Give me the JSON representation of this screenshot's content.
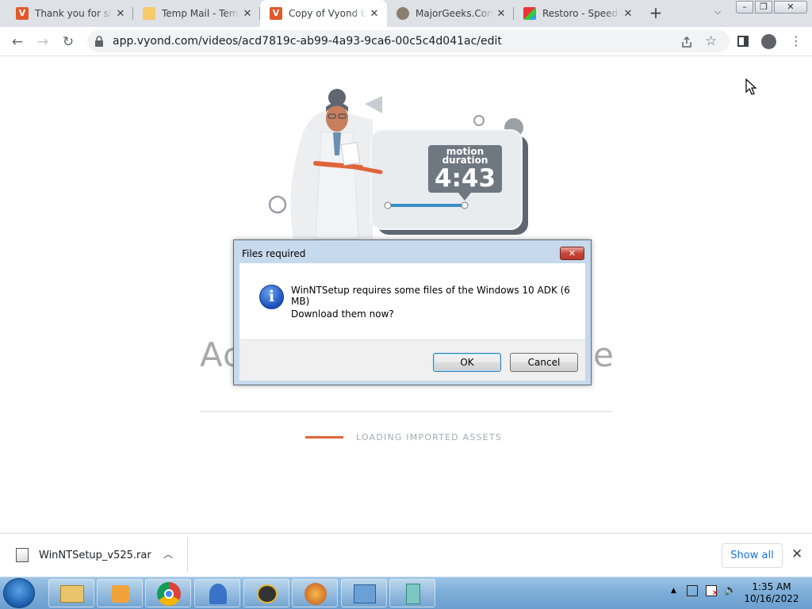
{
  "browser": {
    "tabs": [
      {
        "title": "Thank you for signing up",
        "icon": "vyond-icon",
        "active": false
      },
      {
        "title": "Temp Mail - Temporary Email",
        "icon": "temp-mail-icon",
        "active": false
      },
      {
        "title": "Copy of Vyond basics",
        "icon": "vyond-icon",
        "active": true
      },
      {
        "title": "MajorGeeks.Com",
        "icon": "majorgeeks-icon",
        "active": false
      },
      {
        "title": "Restoro - Speed up",
        "icon": "restoro-icon",
        "active": false
      }
    ],
    "url": "app.vyond.com/videos/acd7819c-ab99-4a93-9ca6-00c5c4d041ac/edit"
  },
  "page": {
    "illustration_badge_line1": "motion",
    "illustration_badge_line2": "duration",
    "illustration_time": "4:43",
    "heading_left": "Ac",
    "heading_right": "e",
    "loading_text": "LOADING IMPORTED ASSETS"
  },
  "dialog": {
    "title": "Files required",
    "message": "WinNTSetup requires some files of the Windows 10 ADK (6 MB)",
    "question": "Download them now?",
    "ok_label": "OK",
    "cancel_label": "Cancel"
  },
  "downloads": {
    "filename": "WinNTSetup_v525.rar",
    "show_all_label": "Show all"
  },
  "taskbar": {
    "time": "1:35 AM",
    "date": "10/16/2022"
  },
  "colors": {
    "accent_orange": "#e0653a",
    "chrome_blue": "#1a73e8",
    "vyond_orange": "#e05a2b"
  }
}
